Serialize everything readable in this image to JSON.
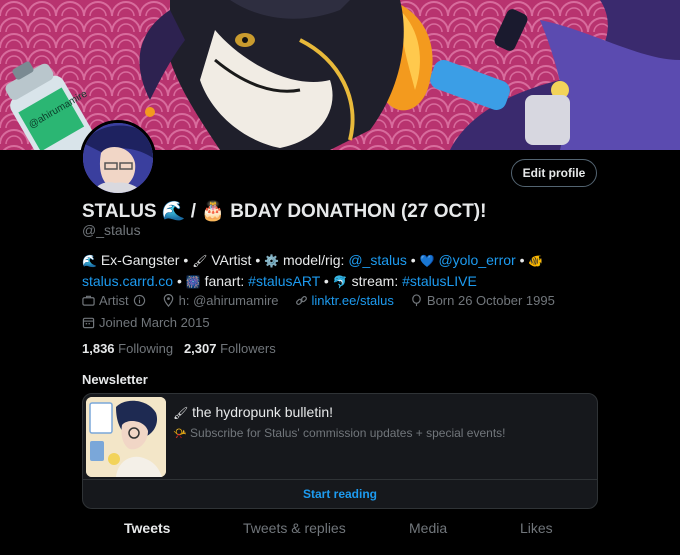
{
  "banner": {
    "label": "@ahirumamire"
  },
  "profile": {
    "edit_button": "Edit profile",
    "display_name": "STALUS 🌊 / 🎂 BDAY DONATHON (27 OCT)!",
    "handle": "@_stalus"
  },
  "bio": {
    "p1": "Ex-Gangster •",
    "p2": "VArtist •",
    "p3": "model/rig:",
    "link_rig": "@_stalus",
    "p4": "•",
    "link_yolo": "@yolo_error",
    "p5": "•",
    "link_carrd": "stalus.carrd.co",
    "p6": "•",
    "p7": "fanart:",
    "link_fanart": "#stalusART",
    "p8": "•",
    "p9": "stream:",
    "link_stream": "#stalusLIVE"
  },
  "meta": {
    "category": "Artist",
    "location": "h: @ahirumamire",
    "link": "linktr.ee/stalus",
    "birthday": "Born 26 October 1995",
    "joined": "Joined March 2015"
  },
  "stats": {
    "following_count": "1,836",
    "following_label": "Following",
    "followers_count": "2,307",
    "followers_label": "Followers"
  },
  "newsletter": {
    "section_label": "Newsletter",
    "title": "the hydropunk bulletin!",
    "subtitle": "Subscribe for Stalus' commission updates + special events!",
    "cta": "Start reading"
  },
  "tabs": [
    {
      "label": "Tweets"
    },
    {
      "label": "Tweets & replies"
    },
    {
      "label": "Media"
    },
    {
      "label": "Likes"
    }
  ],
  "colors": {
    "accent": "#1d9bf0",
    "background": "#000000",
    "muted": "#71767b"
  }
}
